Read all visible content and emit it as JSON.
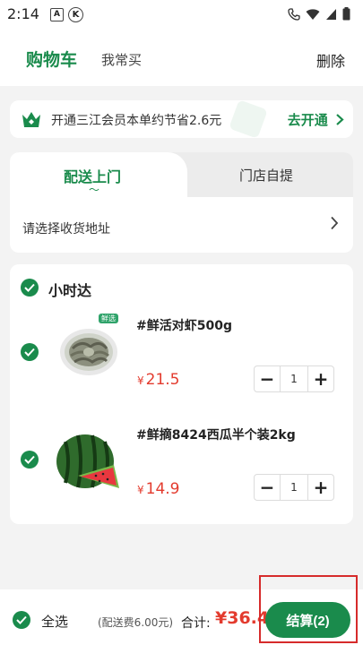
{
  "status_bar": {
    "time": "2:14",
    "icon_a": "A",
    "icon_k": "K"
  },
  "header": {
    "title": "购物车",
    "tab_frequent": "我常买",
    "delete_label": "删除"
  },
  "member_banner": {
    "text": "开通三江会员本单约节省2.6元",
    "link_label": "去开通"
  },
  "delivery": {
    "tabs": [
      {
        "label": "配送上门",
        "active": true
      },
      {
        "label": "门店自提",
        "active": false
      }
    ],
    "address_placeholder": "请选择收货地址"
  },
  "cart": {
    "group_title": "小时达",
    "items": [
      {
        "name": "#鲜活对虾500g",
        "currency": "¥",
        "price": "21.5",
        "qty": "1",
        "badge": "鲜选"
      },
      {
        "name": "#鲜摘8424西瓜半个装2kg",
        "currency": "¥",
        "price": "14.9",
        "qty": "1"
      }
    ]
  },
  "footer": {
    "select_all_label": "全选",
    "delivery_fee": "(配送费6.00元)",
    "total_label": "合计:",
    "total_value": "¥36.4",
    "checkout_label": "结算(2)"
  },
  "colors": {
    "brand": "#1a8b4c",
    "price": "#e33b2e",
    "highlight": "#d62b2b"
  }
}
